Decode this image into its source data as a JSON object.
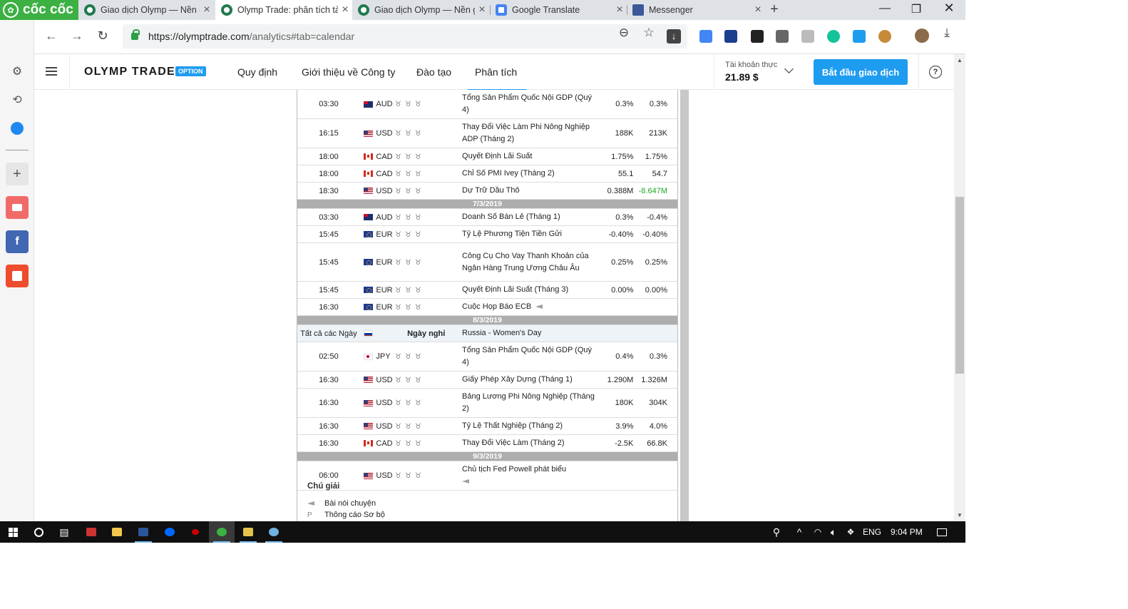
{
  "browser": {
    "brand": "cốc cốc",
    "tabs": [
      {
        "title": "Giao dịch Olymp — Nền g",
        "active": false,
        "icon": "olymp-icon"
      },
      {
        "title": "Olymp Trade: phân tích tà",
        "active": true,
        "icon": "olymp-icon"
      },
      {
        "title": "Giao dịch Olymp — Nền g",
        "active": false,
        "icon": "olymp-icon"
      },
      {
        "title": "Google Translate",
        "active": false,
        "icon": "google-translate-icon"
      },
      {
        "title": "Messenger",
        "active": false,
        "icon": "facebook-icon"
      }
    ],
    "url_domain": "https://olymptrade.com",
    "url_path": "/analytics#tab=calendar"
  },
  "site": {
    "logo": "OLYMP TRADE",
    "badge": "OPTION",
    "nav": [
      "Quy định",
      "Giới thiệu về Công ty",
      "Đào tạo",
      "Phân tích"
    ],
    "active_nav": "Phân tích",
    "account_label": "Tài khoản thực",
    "account_balance": "21.89 $",
    "cta": "Bắt đầu giao dịch"
  },
  "calendar": {
    "rows": [
      {
        "type": "event",
        "time": "03:30",
        "flag": "au",
        "currency": "AUD",
        "event": "Tổng Sản Phẩm Quốc Nội GDP (Quý 4)",
        "actual": "0.3%",
        "forecast": "0.3%"
      },
      {
        "type": "event",
        "time": "16:15",
        "flag": "us",
        "currency": "USD",
        "event": "Thay Đổi Việc Làm Phi Nông Nghiệp ADP (Tháng 2)",
        "actual": "188K",
        "forecast": "213K"
      },
      {
        "type": "event",
        "time": "18:00",
        "flag": "ca",
        "currency": "CAD",
        "event": "Quyết Định Lãi Suất",
        "actual": "1.75%",
        "forecast": "1.75%"
      },
      {
        "type": "event",
        "time": "18:00",
        "flag": "ca",
        "currency": "CAD",
        "event": "Chỉ Số PMI Ivey (Tháng 2)",
        "actual": "55.1",
        "forecast": "54.7"
      },
      {
        "type": "event",
        "time": "18:30",
        "flag": "us",
        "currency": "USD",
        "event": "Dự Trữ Dầu Thô",
        "actual": "0.388M",
        "forecast": "-8.647M",
        "forecast_color": "green"
      },
      {
        "type": "date",
        "label": "7/3/2019"
      },
      {
        "type": "event",
        "time": "03:30",
        "flag": "au",
        "currency": "AUD",
        "event": "Doanh Số Bán Lẻ (Tháng 1)",
        "actual": "0.3%",
        "forecast": "-0.4%"
      },
      {
        "type": "event",
        "time": "15:45",
        "flag": "eu",
        "currency": "EUR",
        "event": "Tỷ Lệ Phương Tiện Tiền Gửi",
        "actual": "-0.40%",
        "forecast": "-0.40%"
      },
      {
        "type": "event",
        "time": "15:45",
        "flag": "eu",
        "currency": "EUR",
        "event": "Công Cụ Cho Vay Thanh Khoản của Ngân Hàng Trung Ương Châu Âu",
        "actual": "0.25%",
        "forecast": "0.25%"
      },
      {
        "type": "event",
        "time": "15:45",
        "flag": "eu",
        "currency": "EUR",
        "event": "Quyết Định Lãi Suất (Tháng 3)",
        "actual": "0.00%",
        "forecast": "0.00%"
      },
      {
        "type": "event",
        "time": "16:30",
        "flag": "eu",
        "currency": "EUR",
        "event": "Cuộc Họp Báo ECB",
        "speech": true,
        "actual": "",
        "forecast": ""
      },
      {
        "type": "date",
        "label": "8/3/2019"
      },
      {
        "type": "holiday",
        "time": "Tất cả các Ngày",
        "flag": "ru",
        "currency": "Ngày nghỉ",
        "event": "Russia - Women's Day"
      },
      {
        "type": "event",
        "time": "02:50",
        "flag": "jp",
        "currency": "JPY",
        "event": "Tổng Sản Phẩm Quốc Nội GDP (Quý 4)",
        "actual": "0.4%",
        "forecast": "0.3%"
      },
      {
        "type": "event",
        "time": "16:30",
        "flag": "us",
        "currency": "USD",
        "event": "Giấy Phép Xây Dựng (Tháng 1)",
        "actual": "1.290M",
        "forecast": "1.326M"
      },
      {
        "type": "event",
        "time": "16:30",
        "flag": "us",
        "currency": "USD",
        "event": "Bảng Lương Phi Nông Nghiệp (Tháng 2)",
        "actual": "180K",
        "forecast": "304K"
      },
      {
        "type": "event",
        "time": "16:30",
        "flag": "us",
        "currency": "USD",
        "event": "Tỷ Lệ Thất Nghiệp (Tháng 2)",
        "actual": "3.9%",
        "forecast": "4.0%"
      },
      {
        "type": "event",
        "time": "16:30",
        "flag": "ca",
        "currency": "CAD",
        "event": "Thay Đổi Việc Làm (Tháng 2)",
        "actual": "-2.5K",
        "forecast": "66.8K"
      },
      {
        "type": "date",
        "label": "9/3/2019"
      },
      {
        "type": "event",
        "time": "06:00",
        "flag": "us",
        "currency": "USD",
        "event": "Chủ tịch Fed Powell phát biểu",
        "speech": true,
        "actual": "",
        "forecast": ""
      }
    ],
    "legend_title": "Chú giải",
    "legend": [
      {
        "icon": "megaphone-icon",
        "label": "Bài nói chuyện"
      },
      {
        "icon": "P",
        "label": "Thông cáo Sơ bộ"
      }
    ]
  },
  "taskbar": {
    "language": "ENG",
    "time": "9:04 PM"
  },
  "colors": {
    "accent": "#1e9cf0",
    "brand_green": "#3cb043",
    "positive": "#1ea81e"
  }
}
